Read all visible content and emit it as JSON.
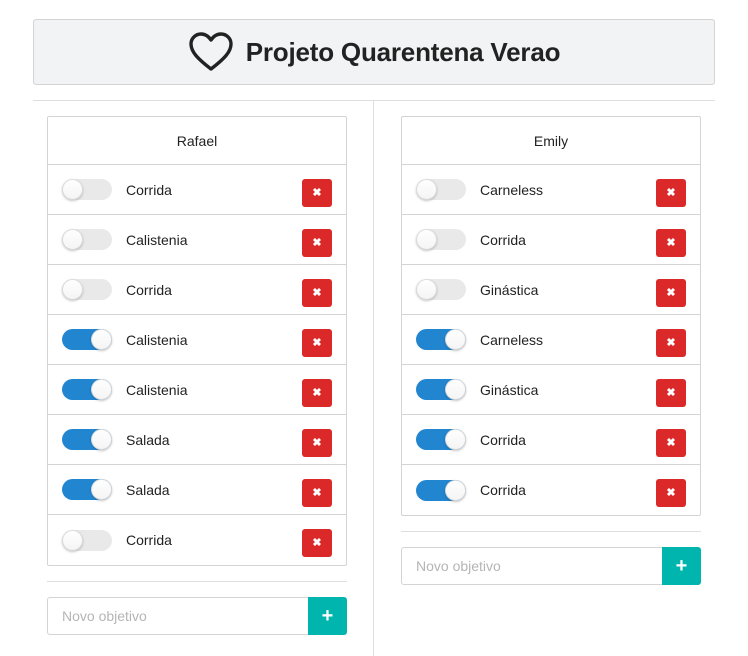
{
  "header": {
    "title": "Projeto Quarentena Verao",
    "icon": "heart-outline-icon"
  },
  "colors": {
    "toggle_on": "#2185d0",
    "toggle_off": "#e9e9e9",
    "delete": "#db2828",
    "add": "#00b5ad"
  },
  "columns": [
    {
      "name": "Rafael",
      "items": [
        {
          "label": "Corrida",
          "done": false
        },
        {
          "label": "Calistenia",
          "done": false
        },
        {
          "label": "Corrida",
          "done": false
        },
        {
          "label": "Calistenia",
          "done": true
        },
        {
          "label": "Calistenia",
          "done": true
        },
        {
          "label": "Salada",
          "done": true
        },
        {
          "label": "Salada",
          "done": true
        },
        {
          "label": "Corrida",
          "done": false
        }
      ],
      "input_placeholder": "Novo objetivo",
      "input_value": "",
      "delete_icon": "✖",
      "add_icon": "+"
    },
    {
      "name": "Emily",
      "items": [
        {
          "label": "Carneless",
          "done": false
        },
        {
          "label": "Corrida",
          "done": false
        },
        {
          "label": "Ginástica",
          "done": false
        },
        {
          "label": "Carneless",
          "done": true
        },
        {
          "label": "Ginástica",
          "done": true
        },
        {
          "label": "Corrida",
          "done": true
        },
        {
          "label": "Corrida",
          "done": true
        }
      ],
      "input_placeholder": "Novo objetivo",
      "input_value": "",
      "delete_icon": "✖",
      "add_icon": "+"
    }
  ]
}
